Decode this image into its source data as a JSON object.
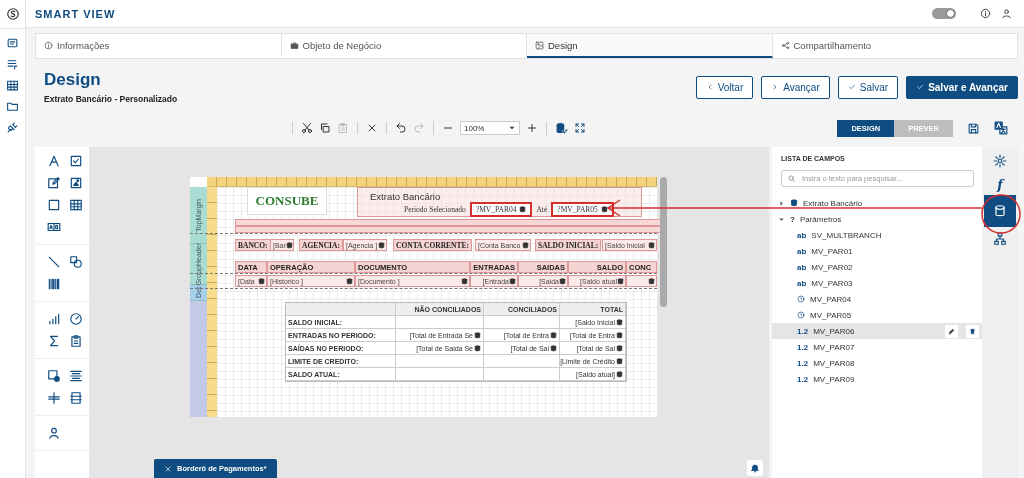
{
  "app": {
    "title": "SMART VIEW",
    "toggle": {
      "on": true
    }
  },
  "tabs": [
    {
      "label": "Informações",
      "kind": "info",
      "selected": false
    },
    {
      "label": "Objeto de Negócio",
      "kind": "briefcase",
      "selected": false
    },
    {
      "label": "Design",
      "kind": "image",
      "selected": true
    },
    {
      "label": "Compartilhamento",
      "kind": "share",
      "selected": false
    }
  ],
  "header": {
    "title": "Design",
    "subtitle": "Extrato Bancário - Personalizado",
    "buttons": [
      {
        "label": "Voltar",
        "kind": "back"
      },
      {
        "label": "Avançar",
        "kind": "next"
      },
      {
        "label": "Salvar",
        "kind": "save"
      },
      {
        "label": "Salvar e Avançar",
        "kind": "primary"
      }
    ]
  },
  "toolbar": {
    "actions": [
      {
        "kind": "cut",
        "disabled": false
      },
      {
        "kind": "copy",
        "disabled": false
      },
      {
        "kind": "paste",
        "disabled": true
      },
      {
        "kind": "delete",
        "disabled": false
      },
      {
        "kind": "undo",
        "disabled": false
      },
      {
        "kind": "redo",
        "disabled": true
      }
    ],
    "zoom": "100%",
    "modes": [
      {
        "label": "DESIGN",
        "selected": true
      },
      {
        "label": "PREVER",
        "selected": false
      }
    ]
  },
  "report": {
    "bands": [
      "TopMargin",
      "GroupHeader",
      "Det"
    ],
    "logo": "CONSUBE",
    "title": "Extrato Bancário",
    "period_label": "Periodo Selecionado",
    "period_from": "?MV_PAR04",
    "period_sep": "Até",
    "period_to": "?MV_PAR05",
    "header_fields": [
      {
        "label": "BANCO:",
        "value": "[Bar"
      },
      {
        "label": "AGENCIA:",
        "value": "[Agencia ]"
      },
      {
        "label": "CONTA CORRENTE:",
        "value": "[Conta Banco"
      },
      {
        "label": "SALDO INICIAL:",
        "value": "[Saldo Inicial"
      }
    ],
    "columns": [
      "DATA",
      "OPERAÇÃO",
      "DOCUMENTO",
      "ENTRADAS",
      "SAIDAS",
      "SALDO",
      "CONC"
    ],
    "detail": [
      "[Data",
      "[Historico ]",
      "[Documento ]",
      "[Entrada",
      "[Saida",
      "[Saldo atual"
    ],
    "summary": {
      "columns": [
        "NÃO CONCILIADOS",
        "CONCILIADOS",
        "TOTAL"
      ],
      "rows": [
        {
          "label": "SALDO INICIAL:",
          "total": "[Saldo Inicial"
        },
        {
          "label": "ENTRADAS NO PERIODO:",
          "not_reconciled": "[Total de Entrada Se",
          "reconciled": "[Total de Entra",
          "total": "[Total de Entra"
        },
        {
          "label": "SAÍDAS NO PERIODO:",
          "not_reconciled": "[Total de Saida Se",
          "reconciled": "[Total de Sai",
          "total": "[Total de Sai"
        },
        {
          "label": "LIMITE DE CREDITO:",
          "total": "[Limite de Crédito"
        },
        {
          "label": "SALDO ATUAL:",
          "total": "[Saldo atual]"
        }
      ]
    }
  },
  "field_list": {
    "title": "LISTA DE CAMPOS",
    "search_placeholder": "Insira o texto para pesquisar...",
    "tree": [
      {
        "label": "Extrato Bancário",
        "kind": "datasource",
        "expanded": false
      },
      {
        "label": "Parâmetros",
        "kind": "parameters",
        "symbol": "?",
        "expanded": true,
        "children": [
          {
            "label": "SV_MULTBRANCH",
            "kind": "text",
            "tag": "ab",
            "selected": false
          },
          {
            "label": "MV_PAR01",
            "kind": "text",
            "tag": "ab",
            "selected": false
          },
          {
            "label": "MV_PAR02",
            "kind": "text",
            "tag": "ab",
            "selected": false
          },
          {
            "label": "MV_PAR03",
            "kind": "text",
            "tag": "ab",
            "selected": false
          },
          {
            "label": "MV_PAR04",
            "kind": "date",
            "selected": false
          },
          {
            "label": "MV_PAR05",
            "kind": "date",
            "selected": false
          },
          {
            "label": "MV_PAR06",
            "kind": "number",
            "tag": "1.2",
            "selected": true
          },
          {
            "label": "MV_PAR07",
            "kind": "number",
            "tag": "1.2",
            "selected": false
          },
          {
            "label": "MV_PAR08",
            "kind": "number",
            "tag": "1.2",
            "selected": false
          },
          {
            "label": "MV_PAR09",
            "kind": "number",
            "tag": "1.2",
            "selected": false
          }
        ]
      }
    ],
    "side_tabs": [
      {
        "kind": "settings",
        "selected": false
      },
      {
        "kind": "function",
        "symbol": "f",
        "selected": false
      },
      {
        "kind": "database",
        "selected": true
      },
      {
        "kind": "hierarchy",
        "selected": false
      }
    ]
  },
  "bottom_tabs": [
    {
      "label": "Borderô de Pagamentos*"
    }
  ]
}
